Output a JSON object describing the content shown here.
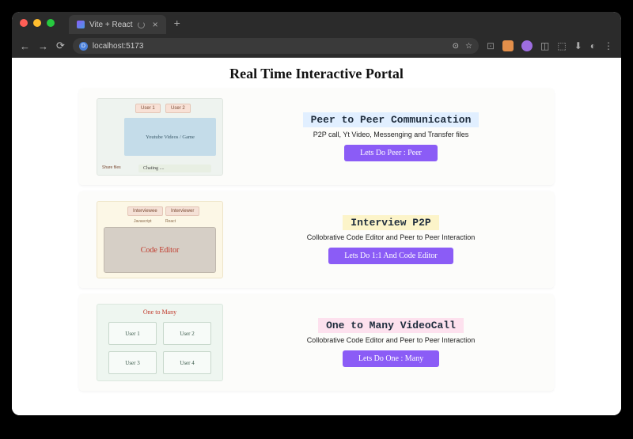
{
  "browser": {
    "tab_title": "Vite + React",
    "url": "localhost:5173"
  },
  "page": {
    "title": "Real Time Interactive Portal"
  },
  "cards": [
    {
      "heading": "Peer to Peer Communication",
      "description": "P2P call, Yt Video, Messenging and Transfer files",
      "cta": "Lets Do Peer : Peer",
      "illus": {
        "user1": "User 1",
        "user2": "User 2",
        "video": "Youtube Videos / Game",
        "share": "Share files",
        "chat": "Chating ...."
      }
    },
    {
      "heading": "Interview P2P",
      "description": "Collobrative Code Editor and Peer to Peer Interaction",
      "cta": "Lets Do 1:1 And Code Editor",
      "illus": {
        "interviewee": "Interviewee",
        "interviewer": "Interviewer",
        "lang1": "Javascript",
        "lang2": "React",
        "editor": "Code Editor"
      }
    },
    {
      "heading": "One to Many VideoCall",
      "description": "Collobrative Code Editor and Peer to Peer Interaction",
      "cta": "Lets Do One : Many",
      "illus": {
        "title": "One to Many",
        "u1": "User 1",
        "u2": "User 2",
        "u3": "User 3",
        "u4": "User 4"
      }
    }
  ]
}
